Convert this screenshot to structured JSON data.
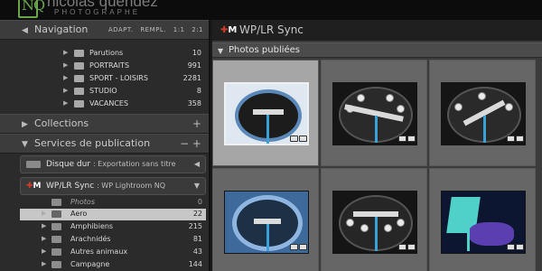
{
  "brand": {
    "logo_letters": "NQ",
    "name": "nicolas quéndez",
    "tagline": "PHOTOGRAPHE",
    "logo_color": "#6aa54a"
  },
  "navigation": {
    "title": "Navigation",
    "modes": [
      "ADAPT.",
      "REMPL.",
      "1:1",
      "2:1"
    ],
    "folders": [
      {
        "name": "Parutions",
        "count": "10"
      },
      {
        "name": "PORTRAITS",
        "count": "991"
      },
      {
        "name": "SPORT - LOISIRS",
        "count": "2281"
      },
      {
        "name": "STUDIO",
        "count": "8"
      },
      {
        "name": "VACANCES",
        "count": "358"
      }
    ]
  },
  "collections": {
    "title": "Collections",
    "add_label": "+"
  },
  "publish_services": {
    "title": "Services de publication",
    "controls": "− +",
    "disk": {
      "name": "Disque dur",
      "subtitle": ": Exportation sans titre"
    },
    "wplr": {
      "name": "WP/LR Sync",
      "subtitle": ": WP Lightroom NQ"
    },
    "items": [
      {
        "name": "Photos",
        "count": "0",
        "style": "italic"
      },
      {
        "name": "Aero",
        "count": "22",
        "style": "selected"
      },
      {
        "name": "Amphibiens",
        "count": "215"
      },
      {
        "name": "Arachnidés",
        "count": "81"
      },
      {
        "name": "Autres animaux",
        "count": "43"
      },
      {
        "name": "Campagne",
        "count": "144"
      }
    ]
  },
  "main": {
    "title": "WP/LR Sync",
    "section": "Photos publiées",
    "selected_cell_color": "#a6a6a6"
  }
}
